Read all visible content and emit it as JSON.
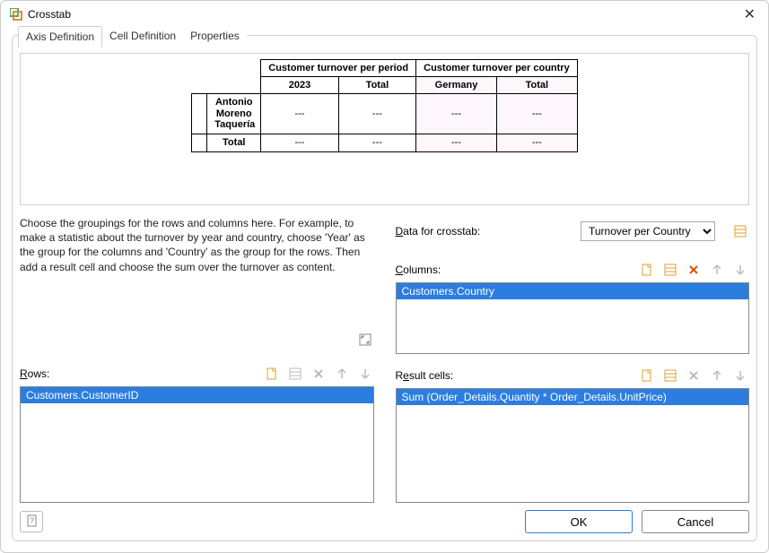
{
  "window": {
    "title": "Crosstab"
  },
  "tabs": [
    {
      "label": "Axis Definition"
    },
    {
      "label": "Cell Definition"
    },
    {
      "label": "Properties"
    }
  ],
  "preview": {
    "group_col_1": "Customer turnover per period",
    "group_col_2": "Customer turnover per country",
    "col_1": "2023",
    "col_2": "Total",
    "col_3": "Germany",
    "col_4": "Total",
    "row_head_1": "Antonio Moreno Taquería",
    "row_head_2": "Total",
    "cell": "---"
  },
  "description": "Choose the groupings for the rows and columns here. For example, to make a statistic about the turnover by year and country, choose 'Year' as the group for the columns and 'Country' as the group for the rows. Then add a result cell and choose the sum over the turnover as content.",
  "labels": {
    "data_for_crosstab": "Data for crosstab:",
    "columns": "Columns:",
    "rows": "Rows:",
    "result_cells": "Result cells:"
  },
  "data_select": {
    "value": "Turnover per Country"
  },
  "columns_items": [
    "Customers.Country"
  ],
  "rows_items": [
    "Customers.CustomerID"
  ],
  "result_items": [
    "Sum (Order_Details.Quantity * Order_Details.UnitPrice)"
  ],
  "buttons": {
    "ok": "OK",
    "cancel": "Cancel"
  }
}
